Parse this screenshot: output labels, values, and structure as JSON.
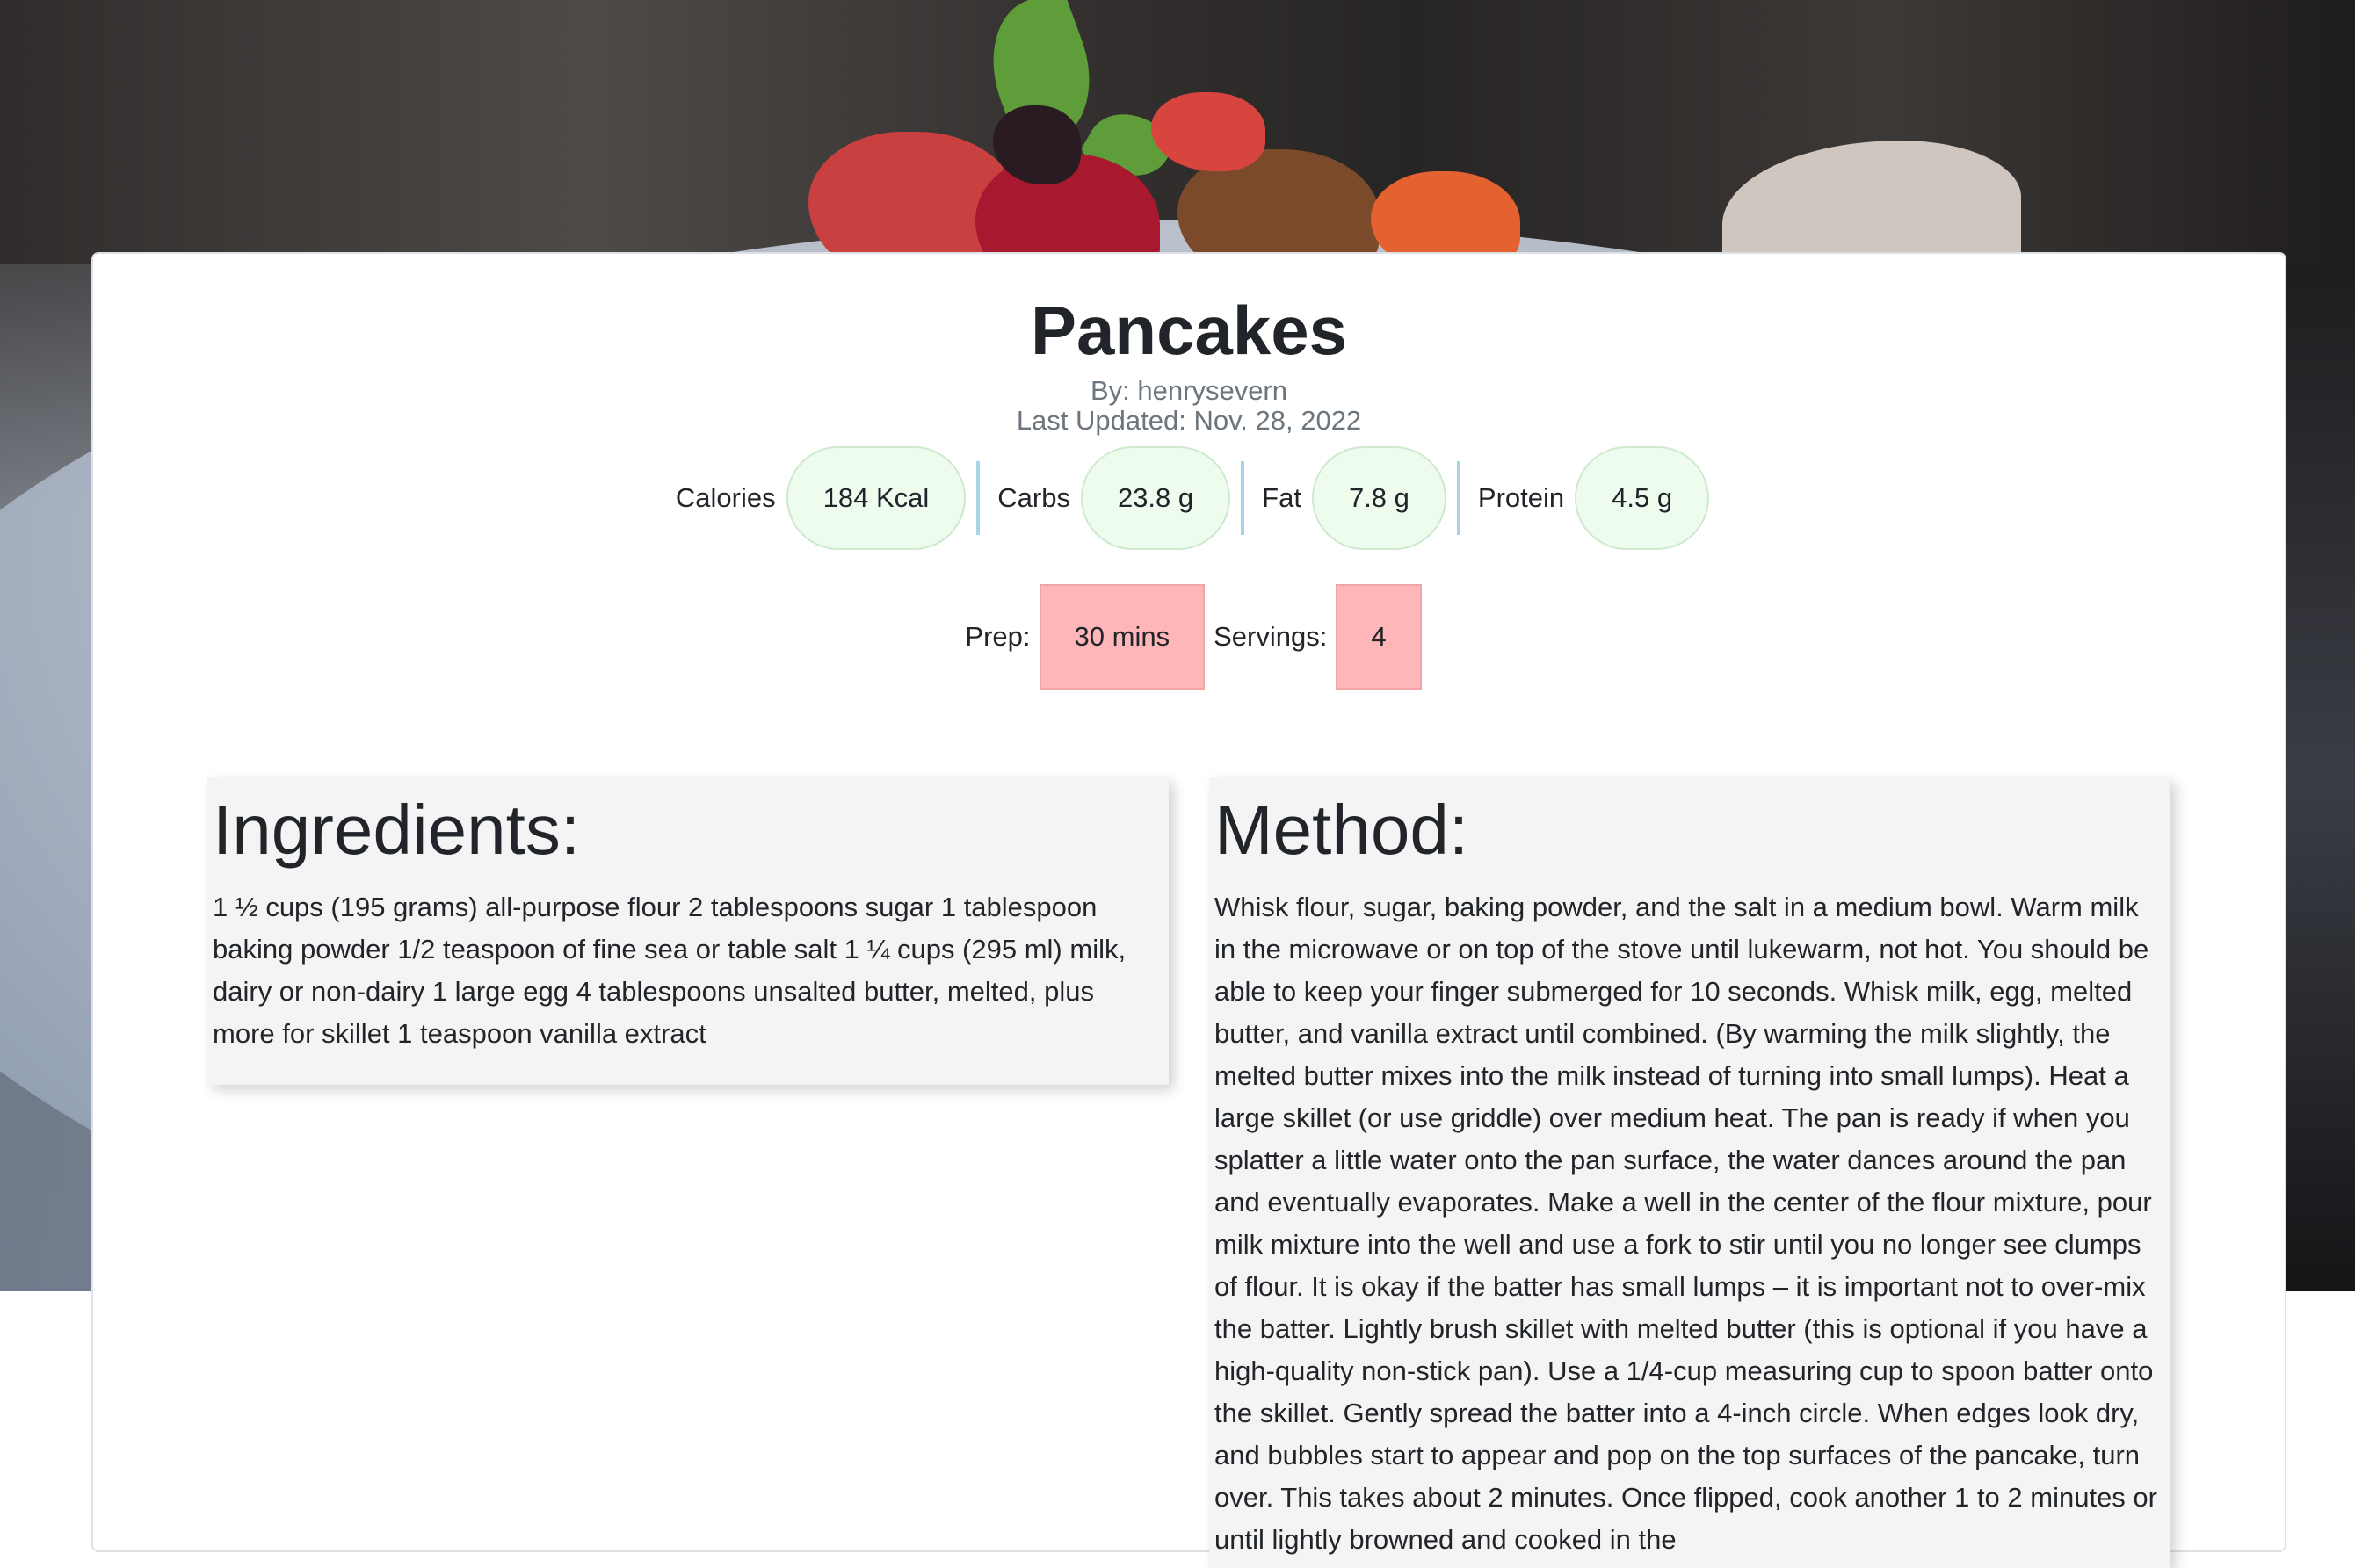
{
  "recipe": {
    "title": "Pancakes",
    "author_line": "By: henrysevern",
    "updated_line": "Last Updated: Nov. 28, 2022"
  },
  "nutrition": [
    {
      "label": "Calories",
      "value": "184 Kcal"
    },
    {
      "label": "Carbs",
      "value": "23.8 g"
    },
    {
      "label": "Fat",
      "value": "7.8 g"
    },
    {
      "label": "Protein",
      "value": "4.5 g"
    }
  ],
  "timing": {
    "prep_label": "Prep:",
    "prep_value": "30 mins",
    "servings_label": "Servings:",
    "servings_value": "4"
  },
  "ingredients": {
    "heading": "Ingredients:",
    "text": "1 ½ cups (195 grams) all-purpose flour 2 tablespoons sugar 1 tablespoon baking powder 1/2 teaspoon of fine sea or table salt 1 ¼ cups (295 ml) milk, dairy or non-dairy 1 large egg 4 tablespoons unsalted butter, melted, plus more for skillet 1 teaspoon vanilla extract"
  },
  "method": {
    "heading": "Method:",
    "text": "Whisk flour, sugar, baking powder, and the salt in a medium bowl. Warm milk in the microwave or on top of the stove until lukewarm, not hot. You should be able to keep your finger submerged for 10 seconds. Whisk milk, egg, melted butter, and vanilla extract until combined. (By warming the milk slightly, the melted butter mixes into the milk instead of turning into small lumps). Heat a large skillet (or use griddle) over medium heat. The pan is ready if when you splatter a little water onto the pan surface, the water dances around the pan and eventually evaporates. Make a well in the center of the flour mixture, pour milk mixture into the well and use a fork to stir until you no longer see clumps of flour. It is okay if the batter has small lumps – it is important not to over-mix the batter. Lightly brush skillet with melted butter (this is optional if you have a high-quality non-stick pan). Use a 1/4-cup measuring cup to spoon batter onto the skillet. Gently spread the batter into a 4-inch circle. When edges look dry, and bubbles start to appear and pop on the top surfaces of the pancake, turn over. This takes about 2 minutes. Once flipped, cook another 1 to 2 minutes or until lightly browned and cooked in the"
  },
  "colors": {
    "nutrition_pill": "#eefcee",
    "nutrition_separator": "#a8d4ea",
    "timing_box": "#ffb6b9",
    "panel_background": "#f4f4f4"
  }
}
